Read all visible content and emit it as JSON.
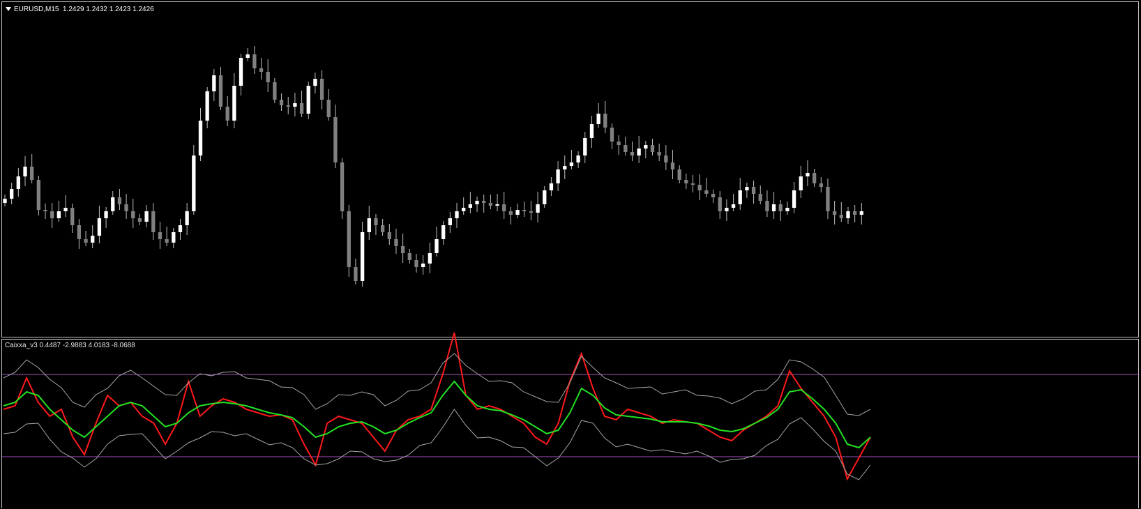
{
  "main": {
    "symbol": "EURUSD,M15",
    "ohlc": "1.2429 1.2432 1.2423 1.2426",
    "colors": {
      "bull": "#ffffff",
      "bear": "#808080",
      "wick": "#c0c0c0"
    }
  },
  "indicator": {
    "label": "Caixxa_v3 0.4487 -2.9883 4.0183 -8.0688",
    "colors": {
      "fast": "#ff1a1a",
      "slow": "#22e322",
      "band": "#a6a6a6",
      "level": "#a050c0"
    }
  }
}
